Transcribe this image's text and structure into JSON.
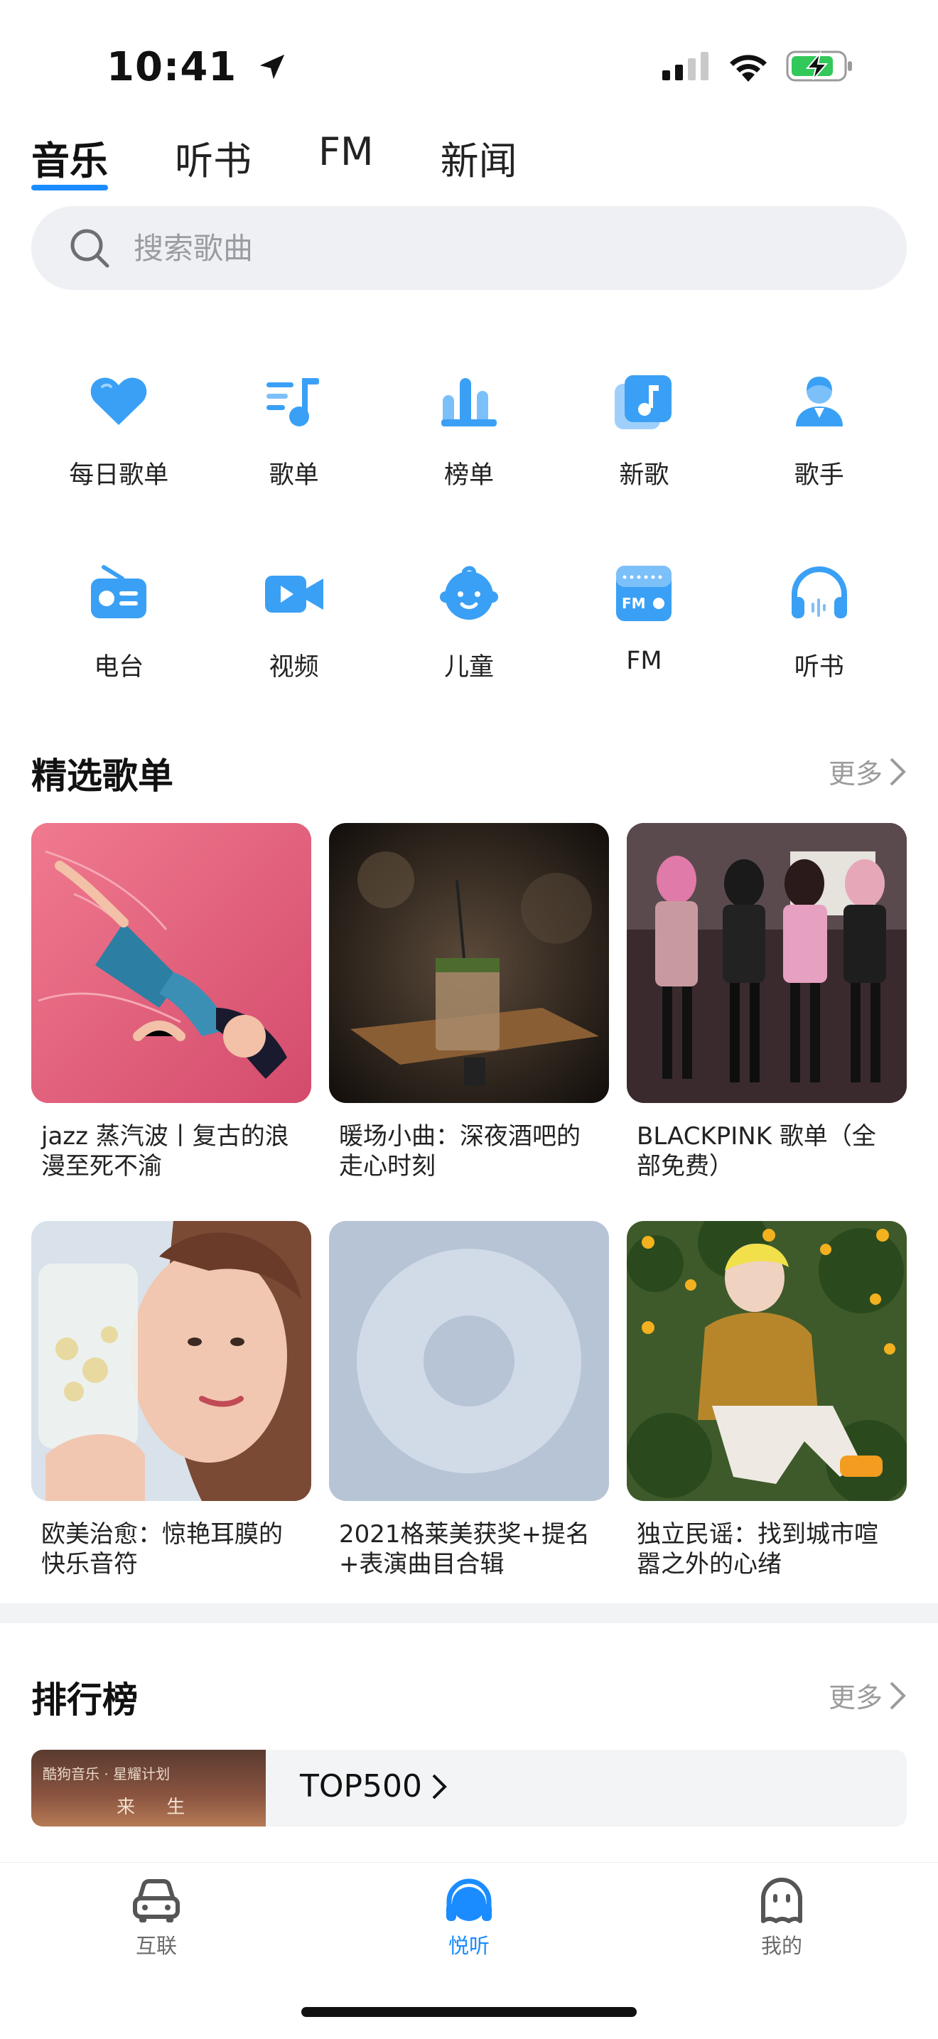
{
  "status_bar": {
    "time": "10:41"
  },
  "tabs": [
    {
      "label": "音乐",
      "active": true
    },
    {
      "label": "听书",
      "active": false
    },
    {
      "label": "FM",
      "active": false
    },
    {
      "label": "新闻",
      "active": false
    }
  ],
  "search": {
    "placeholder": "搜索歌曲"
  },
  "categories": [
    {
      "label": "每日歌单",
      "icon": "heart-icon"
    },
    {
      "label": "歌单",
      "icon": "playlist-icon"
    },
    {
      "label": "榜单",
      "icon": "chart-bars-icon"
    },
    {
      "label": "新歌",
      "icon": "music-note-icon"
    },
    {
      "label": "歌手",
      "icon": "singer-icon"
    },
    {
      "label": "电台",
      "icon": "radio-icon"
    },
    {
      "label": "视频",
      "icon": "video-camera-icon"
    },
    {
      "label": "儿童",
      "icon": "baby-face-icon"
    },
    {
      "label": "FM",
      "icon": "fm-radio-icon"
    },
    {
      "label": "听书",
      "icon": "headphones-icon"
    }
  ],
  "featured": {
    "title": "精选歌单",
    "more": "更多",
    "playlists": [
      {
        "title": "jazz 蒸汽波丨复古的浪漫至死不渝"
      },
      {
        "title": "暖场小曲：深夜酒吧的走心时刻"
      },
      {
        "title": "BLACKPINK 歌单（全部免费）"
      },
      {
        "title": "欧美治愈：惊艳耳膜的快乐音符"
      },
      {
        "title": "2021格莱美获奖+提名+表演曲目合辑"
      },
      {
        "title": "独立民谣：找到城市喧嚣之外的心绪"
      }
    ]
  },
  "ranking": {
    "title": "排行榜",
    "more": "更多",
    "top_label": "TOP500",
    "cover_text": "酷狗音乐 · 星耀计划",
    "cover_sub": "来 生"
  },
  "bottom_nav": [
    {
      "label": "互联",
      "icon": "car-icon",
      "active": false
    },
    {
      "label": "悦听",
      "icon": "headphones-icon",
      "active": true
    },
    {
      "label": "我的",
      "icon": "profile-icon",
      "active": false
    }
  ],
  "colors": {
    "accent": "#1a8cff",
    "icon_blue": "#3aa0f5"
  }
}
